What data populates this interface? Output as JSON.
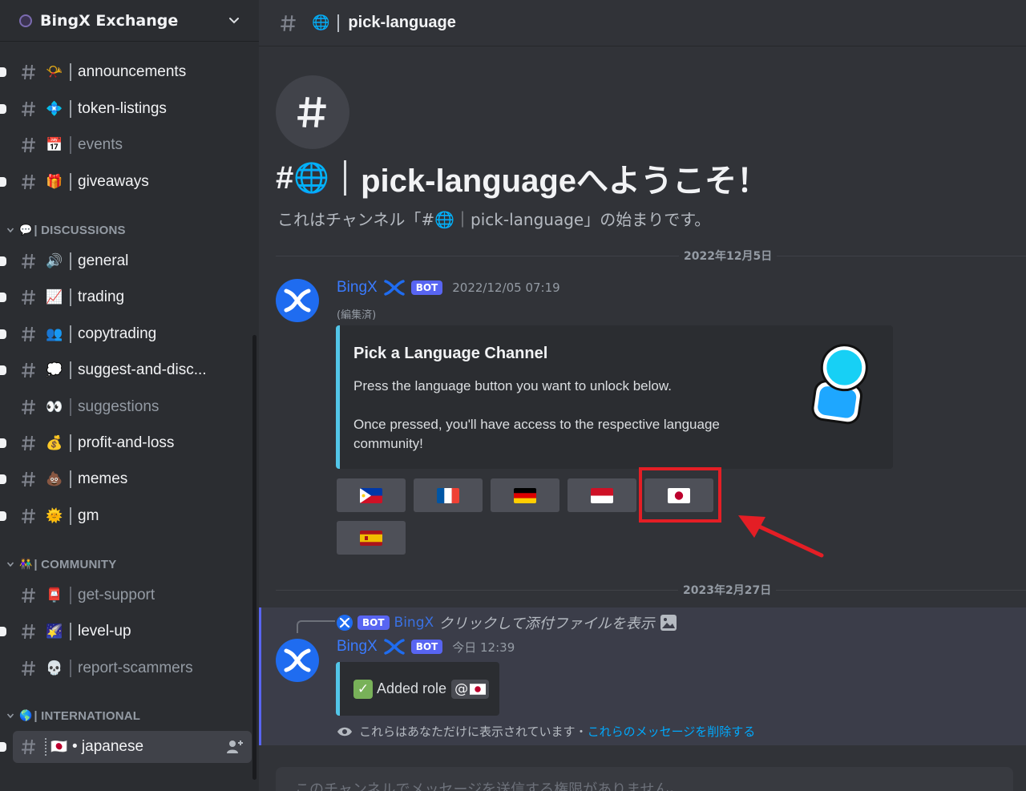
{
  "server": {
    "name": "BingX Exchange"
  },
  "sidebar": {
    "channels_top": [
      {
        "emoji": "📯",
        "name": "announcements"
      },
      {
        "emoji": "💠",
        "name": "token-listings"
      },
      {
        "emoji": "📅",
        "name": "events"
      },
      {
        "emoji": "🎁",
        "name": "giveaways"
      }
    ],
    "categories": [
      {
        "emoji": "💬",
        "name": "| DISCUSSIONS"
      },
      {
        "emoji": "👫",
        "name": "| COMMUNITY"
      },
      {
        "emoji": "🌎",
        "name": "|  INTERNATIONAL"
      }
    ],
    "channels_discussions": [
      {
        "emoji": "🔊",
        "name": "general"
      },
      {
        "emoji": "📈",
        "name": "trading"
      },
      {
        "emoji": "👥",
        "name": "copytrading"
      },
      {
        "emoji": "💭",
        "name": "suggest-and-disc..."
      },
      {
        "emoji": "👀",
        "name": "suggestions"
      },
      {
        "emoji": "💰",
        "name": "profit-and-loss"
      },
      {
        "emoji": "💩",
        "name": "memes"
      },
      {
        "emoji": "🌞",
        "name": "gm"
      }
    ],
    "channels_community": [
      {
        "emoji": "📮",
        "name": "get-support"
      },
      {
        "emoji": "🌠",
        "name": "level-up"
      },
      {
        "emoji": "💀",
        "name": "report-scammers"
      }
    ],
    "channels_international": [
      {
        "emoji": "🇯🇵",
        "name": "• japanese"
      }
    ]
  },
  "channel": {
    "emoji": "🌐",
    "name": "pick-language",
    "welcome_title_suffix": "pick-languageへようこそ！",
    "welcome_sub": "これはチャンネル「#🌐｜pick-language」の始まりです。"
  },
  "dividers": [
    "2022年12月5日",
    "2023年2月27日"
  ],
  "message1": {
    "author": "BingX",
    "badge": "BOT",
    "timestamp": "2022/12/05 07:19",
    "edited": "(編集済)",
    "embed": {
      "title": "Pick a Language Channel",
      "description": "Press the language button you want to unlock below.\n\nOnce pressed, you'll have access to the respective language community!"
    },
    "buttons": [
      "flag-philippines",
      "flag-france",
      "flag-germany",
      "flag-indonesia",
      "flag-japan",
      "flag-spain"
    ]
  },
  "message2": {
    "reply_badge": "BOT",
    "reply_author": "BingX",
    "reply_text": "クリックして添付ファイルを表示",
    "author": "BingX",
    "badge": "BOT",
    "timestamp": "今日 12:39",
    "role_text": "Added role",
    "mention_prefix": "@",
    "ephemeral_note": "これらはあなただけに表示されています・",
    "ephemeral_link": "これらのメッセージを削除する"
  },
  "composer": {
    "placeholder": "このチャンネルでメッセージを送信する権限がありません。"
  },
  "colors": {
    "accent": "#5865f2",
    "link": "#00a8fc",
    "bingx_blue": "#1f6cf0",
    "highlight": "#e41e25"
  }
}
